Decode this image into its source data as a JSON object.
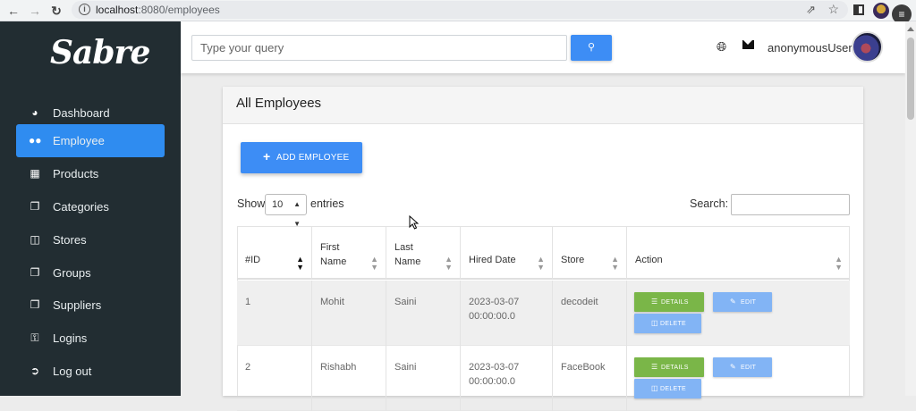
{
  "browser": {
    "url_host": "localhost",
    "url_rest": ":8080/employees"
  },
  "sidebar": {
    "logo": "Sabre",
    "items": [
      {
        "label": "Dashboard",
        "icon": "pie-chart-icon"
      },
      {
        "label": "Employee",
        "icon": "users-icon",
        "active": true
      },
      {
        "label": "Products",
        "icon": "cubes-icon"
      },
      {
        "label": "Categories",
        "icon": "copy-icon"
      },
      {
        "label": "Stores",
        "icon": "store-icon"
      },
      {
        "label": "Groups",
        "icon": "copy-icon"
      },
      {
        "label": "Suppliers",
        "icon": "copy-icon"
      },
      {
        "label": "Logins",
        "icon": "key-icon"
      },
      {
        "label": "Log out",
        "icon": "sign-out-icon"
      }
    ]
  },
  "topbar": {
    "search_placeholder": "Type your query",
    "username": "anonymousUser"
  },
  "card": {
    "title": "All Employees",
    "add_button": "ADD EMPLOYEE",
    "show_label": "Show",
    "entries_value": "10",
    "entries_label": "entries",
    "search_label": "Search:"
  },
  "table": {
    "headers": [
      "#ID",
      "First\nName",
      "Last\nName",
      "Hired Date",
      "Store",
      "Action"
    ],
    "rows": [
      {
        "id": "1",
        "first": "Mohit",
        "last": "Saini",
        "hired_line1": "2023-03-07",
        "hired_line2": "00:00:00.0",
        "store": "decodeit"
      },
      {
        "id": "2",
        "first": "Rishabh",
        "last": "Saini",
        "hired_line1": "2023-03-07",
        "hired_line2": "00:00:00.0",
        "store": "FaceBook"
      }
    ],
    "actions": {
      "details": "DETAILS",
      "edit": "EDIT",
      "delete": "DELETE"
    }
  },
  "colors": {
    "sidebar_bg": "#222d32",
    "accent": "#2f8cf0",
    "details_green": "#7ab648",
    "edit_blue": "#82b4f5"
  }
}
